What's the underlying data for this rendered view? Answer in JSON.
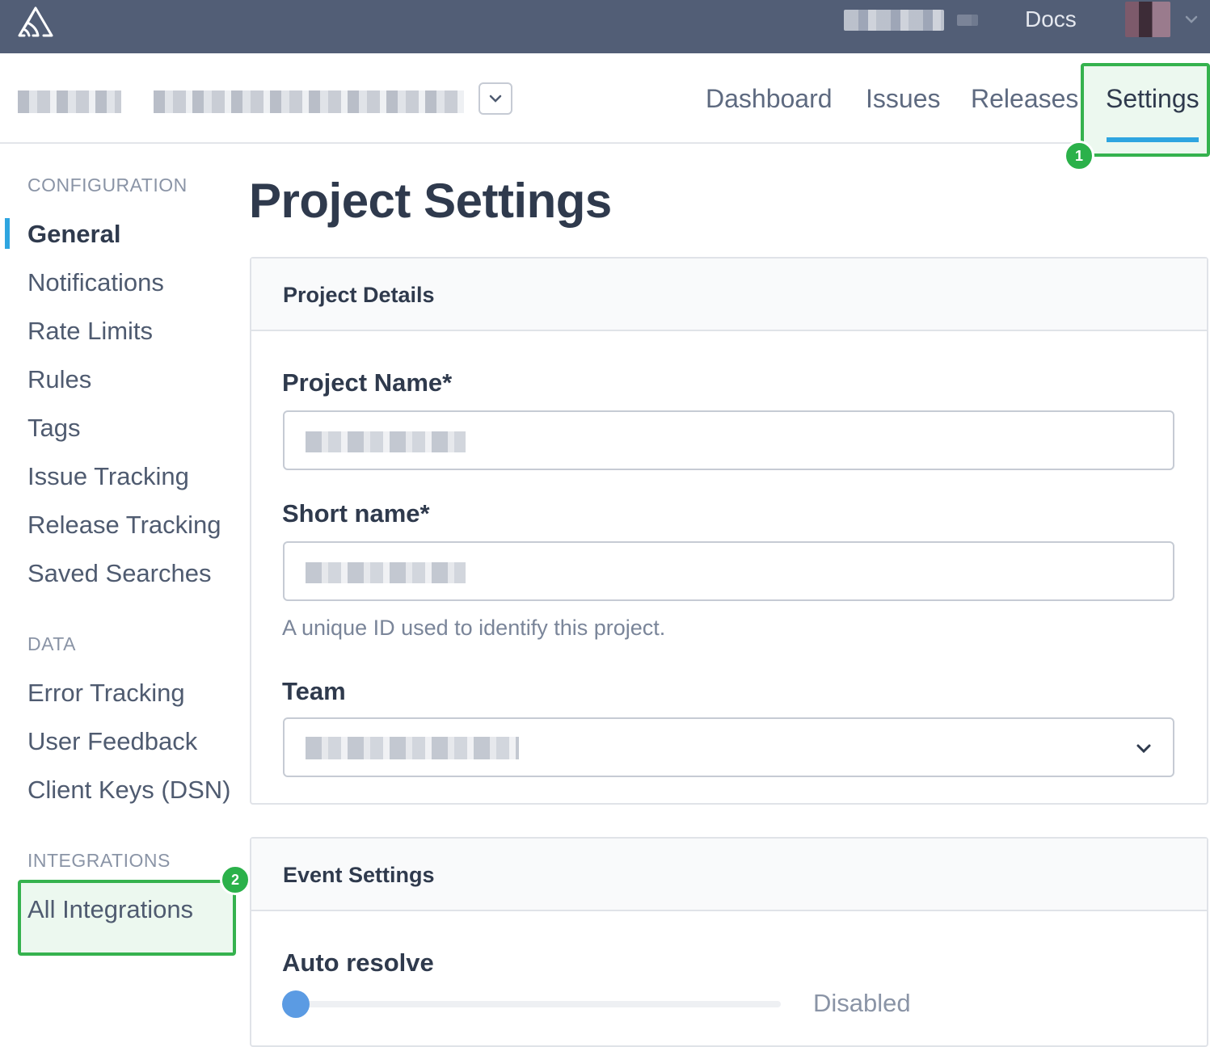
{
  "topbar": {
    "logo_icon": "sentry-logo-icon",
    "docs_label": "Docs",
    "account_chevron_icon": "chevron-down-icon"
  },
  "project_header": {
    "selector_icon": "chevron-down-icon",
    "tabs": [
      {
        "label": "Dashboard",
        "active": false
      },
      {
        "label": "Issues",
        "active": false
      },
      {
        "label": "Releases",
        "active": false
      },
      {
        "label": "Settings",
        "active": true
      }
    ]
  },
  "annotations": {
    "badge_1": "1",
    "badge_2": "2",
    "highlight_color": "#35b24e"
  },
  "sidebar": {
    "sections": [
      {
        "heading": "CONFIGURATION",
        "items": [
          "General",
          "Notifications",
          "Rate Limits",
          "Rules",
          "Tags",
          "Issue Tracking",
          "Release Tracking",
          "Saved Searches"
        ]
      },
      {
        "heading": "DATA",
        "items": [
          "Error Tracking",
          "User Feedback",
          "Client Keys (DSN)"
        ]
      },
      {
        "heading": "INTEGRATIONS",
        "items": [
          "All Integrations"
        ]
      }
    ],
    "active_item": "General"
  },
  "main": {
    "title": "Project Settings",
    "project_details": {
      "heading": "Project Details",
      "project_name_label": "Project Name*",
      "short_name_label": "Short name*",
      "short_name_help": "A unique ID used to identify this project.",
      "team_label": "Team"
    },
    "event_settings": {
      "heading": "Event Settings",
      "auto_resolve_label": "Auto resolve",
      "auto_resolve_value": "Disabled",
      "auto_resolve_level": 0
    }
  },
  "colors": {
    "topbar": "#525e76",
    "accent": "#2ea5e0",
    "highlight_fill": "#ecf8ef",
    "slider_thumb": "#5b9be3"
  }
}
